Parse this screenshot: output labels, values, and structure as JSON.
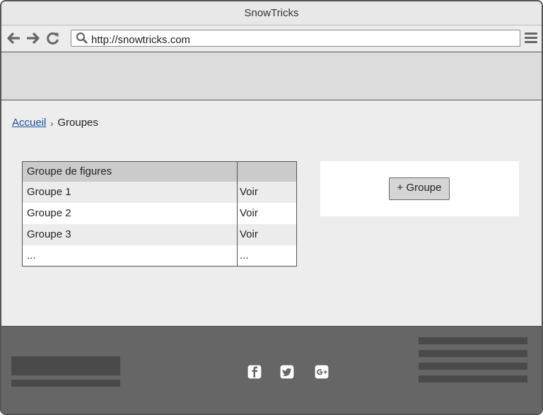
{
  "window": {
    "title": "SnowTricks"
  },
  "toolbar": {
    "back_icon": "arrow-left-icon",
    "forward_icon": "arrow-right-icon",
    "reload_icon": "reload-icon",
    "search_icon": "search-icon",
    "menu_icon": "hamburger-menu-icon",
    "url": "http://snowtricks.com"
  },
  "breadcrumb": {
    "home": "Accueil",
    "separator_icon": "chevron-right-icon",
    "separator": "›",
    "current": "Groupes"
  },
  "table": {
    "headers": [
      "Groupe de figures",
      ""
    ],
    "rows": [
      {
        "name": "Groupe 1",
        "action": "Voir"
      },
      {
        "name": "Groupe 2",
        "action": "Voir"
      },
      {
        "name": "Groupe 3",
        "action": "Voir"
      },
      {
        "name": "...",
        "action": "..."
      }
    ]
  },
  "actions": {
    "add_group_label": "+ Groupe"
  },
  "footer": {
    "social_icons": [
      "facebook-icon",
      "twitter-icon",
      "google-plus-icon"
    ]
  },
  "colors": {
    "link": "#1f4f9a",
    "footer_bg": "#666666",
    "header_band": "#dcdcdc",
    "table_header": "#cbcbcb"
  }
}
